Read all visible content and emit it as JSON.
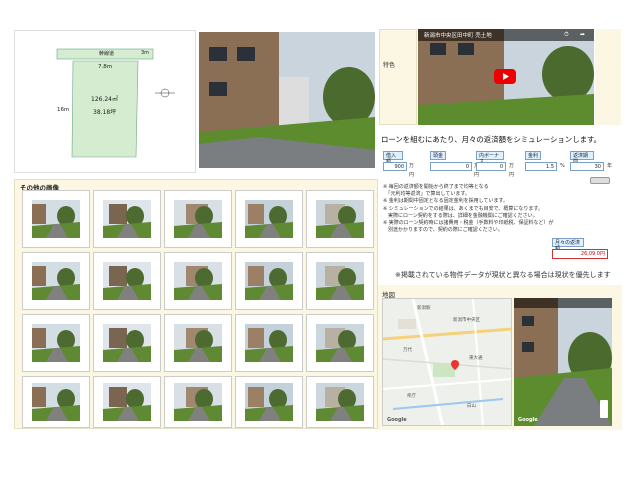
{
  "plot": {
    "road_label": "幹線道",
    "road_width": "3m",
    "frontage": "7.8m",
    "depth": "16m",
    "area_m2": "126.24㎡",
    "area_tsubo": "38.18坪"
  },
  "video": {
    "side_label": "特色",
    "title": "新潟市中央区田中町 売土地"
  },
  "loan": {
    "heading": "ローンを組むにあたり、月々の返済額をシミュレーションします。",
    "fields": [
      {
        "label": "借入額",
        "value": "900",
        "unit": "万円"
      },
      {
        "label": "頭金",
        "value": "0",
        "unit": "万円"
      },
      {
        "label": "内ボーナス",
        "value": "0",
        "unit": "万円"
      },
      {
        "label": "金利",
        "value": "1.5",
        "unit": "%"
      },
      {
        "label": "返済期間",
        "value": "30",
        "unit": "年"
      }
    ],
    "notes": [
      "※ 毎回の返済額を開始から終了まで均等となる",
      "　「元利均等返済」で算出しています。",
      "※ 金利は期間中固定となる固定金利を採用しています。",
      "※ シミュレーションでの結果は、あくまでも目安で、概算になります。",
      "　実際にローン契約をする際は、詳細を金融機関にご確認ください。",
      "※ 実際のローン契約時には諸費用・税金（手数料や印紙税、保証料など）が",
      "　別途かかりますので、契約の際にご確認ください。"
    ],
    "monthly_label": "月々の返済額",
    "monthly_value": "26,09 0円"
  },
  "notice": "※掲載されている物件データが現状と異なる場合は現状を優先します",
  "map": {
    "label": "地図",
    "google": "Google",
    "labels": [
      "新潟駅",
      "新潟市中央区",
      "万代",
      "東大通",
      "県庁",
      "白山"
    ]
  },
  "gallery": {
    "title": "その他の画像"
  }
}
